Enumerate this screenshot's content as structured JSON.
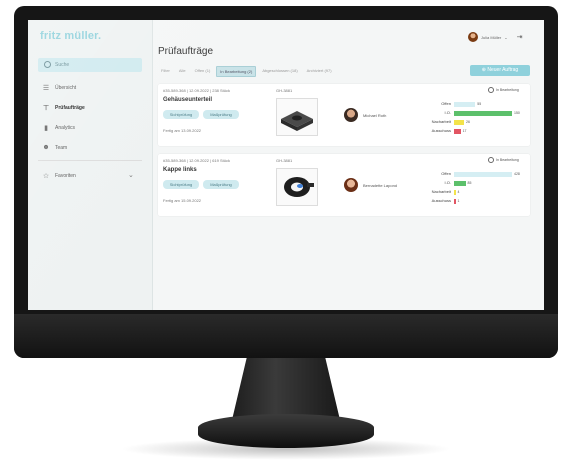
{
  "app": {
    "logo": "fritz müller."
  },
  "sidebar": {
    "search_placeholder": "Suche",
    "items": [
      {
        "label": "Übersicht",
        "icon": "list-icon"
      },
      {
        "label": "Prüfaufträge",
        "icon": "caliper-icon"
      },
      {
        "label": "Analytics",
        "icon": "bar-chart-icon"
      },
      {
        "label": "Team",
        "icon": "team-icon"
      }
    ],
    "favorites": "Favoriten"
  },
  "header": {
    "user_name": "Julia Müller",
    "title": "Prüfaufträge",
    "new_button": "Neuer Auftrag"
  },
  "filters": {
    "label": "Filter",
    "options": [
      "Alle",
      "Offen (1)",
      "In Bearbeitung (2)",
      "Abgeschlossen (18)",
      "Archiviert (97)"
    ],
    "selected": "In Bearbeitung (2)"
  },
  "colors": {
    "accent": "#8fd1dc",
    "offen": "#d5eef3",
    "io": "#5cc06b",
    "nacharbeit": "#f3e34a",
    "ausschuss": "#e25563"
  },
  "cards": [
    {
      "meta": "#35-589-368 | 12.09.2022 | 238 Stück",
      "gh": "GH-3881",
      "name": "Gehäuseunterteil",
      "tags": [
        "Sichtprüfung",
        "Maßprüfung"
      ],
      "due": "Fertig am 13.09.2022",
      "person": "Michael Roth",
      "status": "In Bearbeitung",
      "metrics": [
        {
          "label": "Offen",
          "value": 55,
          "color": "#d5eef3"
        },
        {
          "label": "I.O.",
          "value": 150,
          "color": "#5cc06b"
        },
        {
          "label": "Nacharbeit",
          "value": 26,
          "color": "#f3e34a"
        },
        {
          "label": "Ausschuss",
          "value": 17,
          "color": "#e25563"
        }
      ]
    },
    {
      "meta": "#35-589-368 | 12.09.2022 | 619 Stück",
      "gh": "GH-3881",
      "name": "Kappe links",
      "tags": [
        "Sichtprüfung",
        "Maßprüfung"
      ],
      "due": "Fertig am 15.09.2022",
      "person": "Bernadette Lapond",
      "status": "In Bearbeitung",
      "metrics": [
        {
          "label": "Offen",
          "value": 428,
          "color": "#d5eef3"
        },
        {
          "label": "I.O.",
          "value": 85,
          "color": "#5cc06b"
        },
        {
          "label": "Nacharbeit",
          "value": 4,
          "color": "#f3e34a"
        },
        {
          "label": "Ausschuss",
          "value": 1,
          "color": "#e25563"
        }
      ]
    }
  ]
}
